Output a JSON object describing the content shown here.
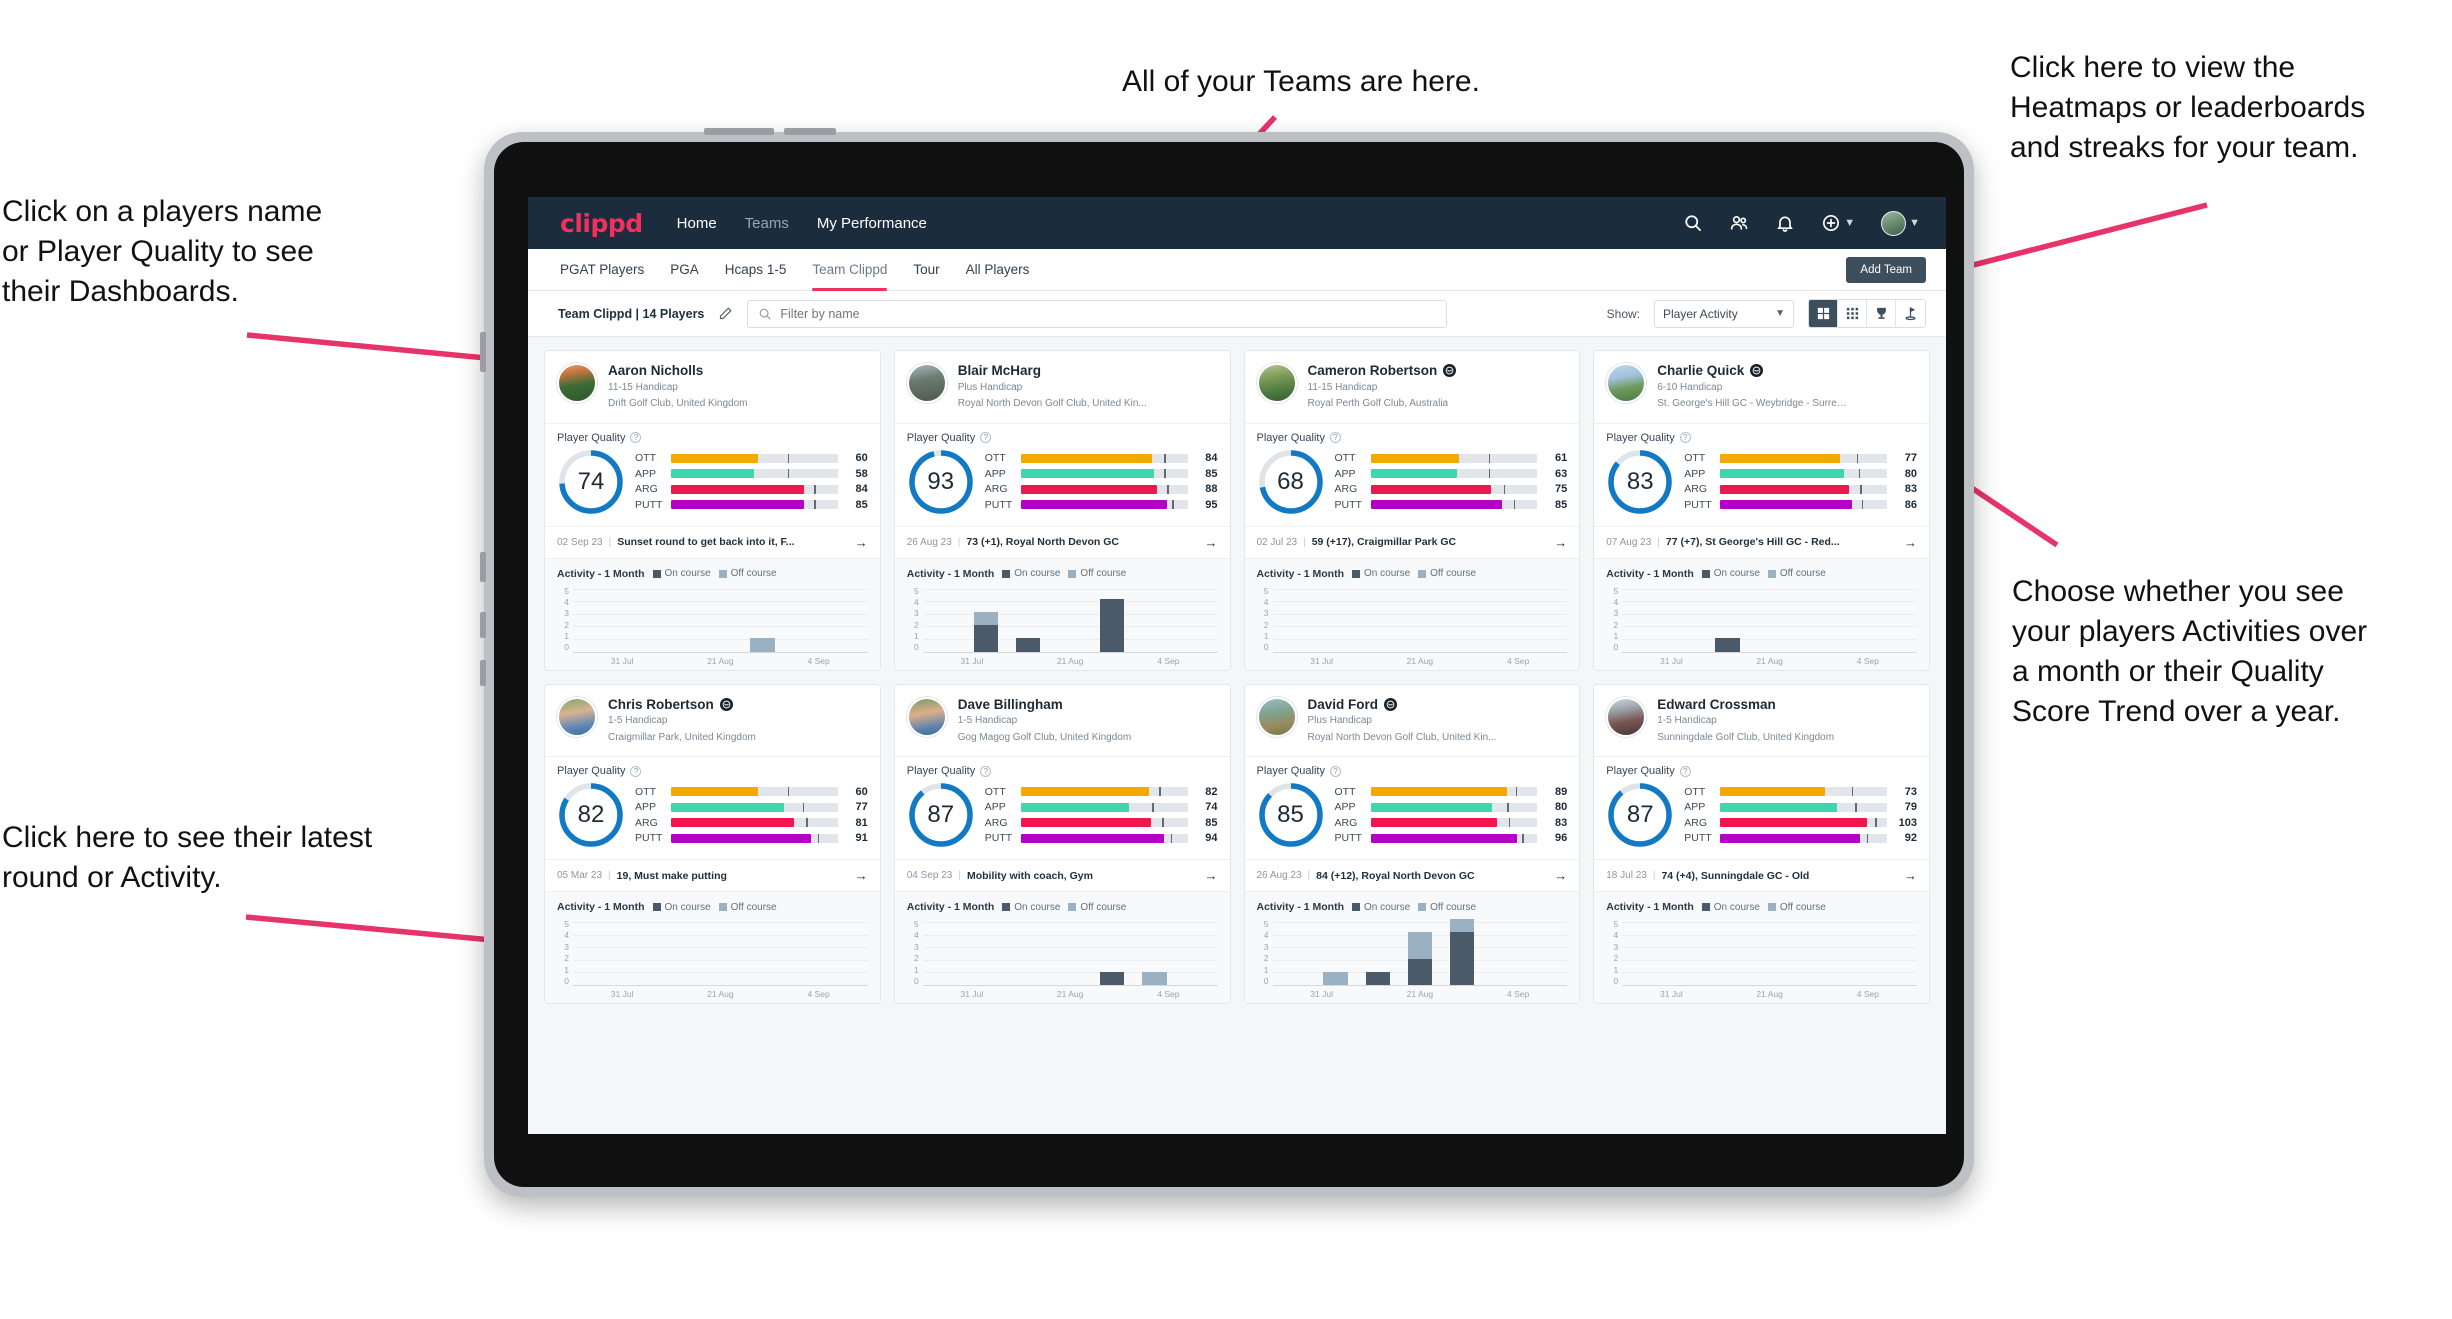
{
  "annotations": [
    {
      "id": "players-name",
      "text": "Click on a players name\nor Player Quality to see\ntheir Dashboards."
    },
    {
      "id": "teams-here",
      "text": "All of your Teams are here."
    },
    {
      "id": "heatmaps",
      "text": "Click here to view the\nHeatmaps or leaderboards\nand streaks for your team."
    },
    {
      "id": "activities-quality",
      "text": "Choose whether you see\nyour players Activities over\na month or their Quality\nScore Trend over a year."
    },
    {
      "id": "latest-round",
      "text": "Click here to see their latest\nround or Activity."
    }
  ],
  "app": {
    "logo": "clippd",
    "nav": [
      {
        "label": "Home",
        "active": true
      },
      {
        "label": "Teams",
        "active": false
      },
      {
        "label": "My Performance",
        "active": true
      }
    ],
    "header_icons": [
      "search-icon",
      "people-icon",
      "bell-icon",
      "plus-circle-icon",
      "avatar"
    ],
    "tabs": [
      {
        "label": "PGAT Players",
        "active": false
      },
      {
        "label": "PGA",
        "active": false
      },
      {
        "label": "Hcaps 1-5",
        "active": false
      },
      {
        "label": "Team Clippd",
        "active": true
      },
      {
        "label": "Tour",
        "active": false
      },
      {
        "label": "All Players",
        "active": false
      }
    ],
    "add_team_label": "Add Team",
    "toolbar": {
      "team_label": "Team Clippd | 14 Players",
      "edit_icon": "pencil-icon",
      "search_placeholder": "Filter by name",
      "search_value": "",
      "show_label": "Show:",
      "show_selected": "Player Activity",
      "show_options": [
        "Player Activity",
        "Quality Score Trend"
      ],
      "view_toggles": [
        {
          "name": "grid-large-view",
          "active": true
        },
        {
          "name": "grid-small-view",
          "active": false
        },
        {
          "name": "leaderboard-trophy-view",
          "active": false
        },
        {
          "name": "heatmap-flag-view",
          "active": false
        }
      ]
    },
    "card_labels": {
      "player_quality": "Player Quality",
      "activity": "Activity - 1 Month",
      "legend_on": "On course",
      "legend_off": "Off course"
    },
    "colors": {
      "brand_pink": "#f0305e",
      "header_navy": "#1b2c3c",
      "ring_blue": "#1279c4",
      "ott": "#f5a800",
      "app": "#3fd6ae",
      "arg": "#f0174f",
      "putt": "#b500c8",
      "on_course": "#4a5a68",
      "off_course": "#9ab0c3"
    }
  },
  "chart_data": {
    "type": "bar",
    "title": "Activity - 1 Month",
    "ylabel": "",
    "xlabel": "",
    "ylim": [
      0,
      5
    ],
    "yticks": [
      0,
      1,
      2,
      3,
      4,
      5
    ],
    "xticks": [
      "31 Jul",
      "21 Aug",
      "4 Sep"
    ],
    "legend": [
      "On course",
      "Off course"
    ],
    "legend_position": "top",
    "grid": true,
    "charts": [
      {
        "player": "Aaron Nicholls",
        "on_course": [
          0,
          0,
          0,
          0,
          0,
          0,
          0
        ],
        "off_course": [
          0,
          0,
          0,
          0,
          1,
          0,
          0
        ]
      },
      {
        "player": "Blair McHarg",
        "on_course": [
          0,
          2,
          1,
          0,
          4,
          0,
          0
        ],
        "off_course": [
          0,
          1,
          0,
          0,
          0,
          0,
          0
        ]
      },
      {
        "player": "Cameron Robertson",
        "on_course": [
          0,
          0,
          0,
          0,
          0,
          0,
          0
        ],
        "off_course": [
          0,
          0,
          0,
          0,
          0,
          0,
          0
        ]
      },
      {
        "player": "Charlie Quick",
        "on_course": [
          0,
          0,
          1,
          0,
          0,
          0,
          0
        ],
        "off_course": [
          0,
          0,
          0,
          0,
          0,
          0,
          0
        ]
      },
      {
        "player": "Chris Robertson",
        "on_course": [
          0,
          0,
          0,
          0,
          0,
          0,
          0
        ],
        "off_course": [
          0,
          0,
          0,
          0,
          0,
          0,
          0
        ]
      },
      {
        "player": "Dave Billingham",
        "on_course": [
          0,
          0,
          0,
          0,
          1,
          0,
          0
        ],
        "off_course": [
          0,
          0,
          0,
          0,
          0,
          1,
          0
        ]
      },
      {
        "player": "David Ford",
        "on_course": [
          0,
          0,
          1,
          2,
          4,
          0,
          0
        ],
        "off_course": [
          0,
          1,
          0,
          2,
          1,
          0,
          0
        ]
      },
      {
        "player": "Edward Crossman",
        "on_course": [
          0,
          0,
          0,
          0,
          0,
          0,
          0
        ],
        "off_course": [
          0,
          0,
          0,
          0,
          0,
          0,
          0
        ]
      }
    ]
  },
  "players": [
    {
      "name": "Aaron Nicholls",
      "verified": false,
      "handicap": "11-15 Handicap",
      "club": "Drift Golf Club, United Kingdom",
      "quality": 74,
      "ring_pct": 74,
      "metrics": [
        {
          "label": "OTT",
          "value": 60,
          "fill": 52,
          "tick": 70
        },
        {
          "label": "APP",
          "value": 58,
          "fill": 50,
          "tick": 70
        },
        {
          "label": "ARG",
          "value": 84,
          "fill": 80,
          "tick": 86
        },
        {
          "label": "PUTT",
          "value": 85,
          "fill": 80,
          "tick": 86
        }
      ],
      "latest_date": "02 Sep 23",
      "latest_text": "Sunset round to get back into it, F...",
      "avatar_css": "linear-gradient(170deg,#e9a07a 0%,#c9763f 22%,#3c6b36 55%,#2c5a2c 100%)"
    },
    {
      "name": "Blair McHarg",
      "verified": false,
      "handicap": "Plus Handicap",
      "club": "Royal North Devon Golf Club, United Kin...",
      "quality": 93,
      "ring_pct": 96,
      "metrics": [
        {
          "label": "OTT",
          "value": 84,
          "fill": 79,
          "tick": 86
        },
        {
          "label": "APP",
          "value": 85,
          "fill": 80,
          "tick": 86
        },
        {
          "label": "ARG",
          "value": 88,
          "fill": 82,
          "tick": 88
        },
        {
          "label": "PUTT",
          "value": 95,
          "fill": 88,
          "tick": 91
        }
      ],
      "latest_date": "26 Aug 23",
      "latest_text": "73 (+1), Royal North Devon GC",
      "avatar_css": "linear-gradient(170deg,#a8b6bd 0%,#6b7b70 40%,#4c5a4a 100%)"
    },
    {
      "name": "Cameron Robertson",
      "verified": true,
      "handicap": "11-15 Handicap",
      "club": "Royal Perth Golf Club, Australia",
      "quality": 68,
      "ring_pct": 72,
      "metrics": [
        {
          "label": "OTT",
          "value": 61,
          "fill": 53,
          "tick": 71
        },
        {
          "label": "APP",
          "value": 63,
          "fill": 52,
          "tick": 71
        },
        {
          "label": "ARG",
          "value": 75,
          "fill": 72,
          "tick": 80
        },
        {
          "label": "PUTT",
          "value": 85,
          "fill": 79,
          "tick": 86
        }
      ],
      "latest_date": "02 Jul 23",
      "latest_text": "59 (+17), Craigmillar Park GC",
      "avatar_css": "linear-gradient(170deg,#b9c48f 0%,#7d9a5a 35%,#4d7a3e 70%,#3b5c2f 100%)"
    },
    {
      "name": "Charlie Quick",
      "verified": true,
      "handicap": "6-10 Handicap",
      "club": "St. George's Hill GC - Weybridge - Surrey, ...",
      "quality": 83,
      "ring_pct": 86,
      "metrics": [
        {
          "label": "OTT",
          "value": 77,
          "fill": 72,
          "tick": 82
        },
        {
          "label": "APP",
          "value": 80,
          "fill": 74,
          "tick": 83
        },
        {
          "label": "ARG",
          "value": 83,
          "fill": 77,
          "tick": 84
        },
        {
          "label": "PUTT",
          "value": 86,
          "fill": 79,
          "tick": 85
        }
      ],
      "latest_date": "07 Aug 23",
      "latest_text": "77 (+7), St George's Hill GC - Red...",
      "avatar_css": "linear-gradient(170deg,#bcd6ea 0%,#9fc2db 35%,#6f9a5d 62%,#4e7a42 100%)"
    },
    {
      "name": "Chris Robertson",
      "verified": true,
      "handicap": "1-5 Handicap",
      "club": "Craigmillar Park, United Kingdom",
      "quality": 82,
      "ring_pct": 84,
      "metrics": [
        {
          "label": "OTT",
          "value": 60,
          "fill": 52,
          "tick": 70
        },
        {
          "label": "APP",
          "value": 77,
          "fill": 68,
          "tick": 79
        },
        {
          "label": "ARG",
          "value": 81,
          "fill": 74,
          "tick": 81
        },
        {
          "label": "PUTT",
          "value": 91,
          "fill": 84,
          "tick": 88
        }
      ],
      "latest_date": "05 Mar 23",
      "latest_text": "19, Must make putting",
      "avatar_css": "linear-gradient(170deg,#7fa86a 0%,#d8b292 38%,#5d86b6 74%,#3f6f96 100%)"
    },
    {
      "name": "Dave Billingham",
      "verified": false,
      "handicap": "1-5 Handicap",
      "club": "Gog Magog Golf Club, United Kingdom",
      "quality": 87,
      "ring_pct": 89,
      "metrics": [
        {
          "label": "OTT",
          "value": 82,
          "fill": 77,
          "tick": 83
        },
        {
          "label": "APP",
          "value": 74,
          "fill": 65,
          "tick": 79
        },
        {
          "label": "ARG",
          "value": 85,
          "fill": 78,
          "tick": 85
        },
        {
          "label": "PUTT",
          "value": 94,
          "fill": 86,
          "tick": 90
        }
      ],
      "latest_date": "04 Sep 23",
      "latest_text": "Mobility with coach, Gym",
      "avatar_css": "linear-gradient(170deg,#7c9b64 0%,#dcae8c 40%,#5a7fae 78%,#3c6a92 100%)"
    },
    {
      "name": "David Ford",
      "verified": true,
      "handicap": "Plus Handicap",
      "club": "Royal North Devon Golf Club, United Kin...",
      "quality": 85,
      "ring_pct": 87,
      "metrics": [
        {
          "label": "OTT",
          "value": 89,
          "fill": 82,
          "tick": 87
        },
        {
          "label": "APP",
          "value": 80,
          "fill": 73,
          "tick": 82
        },
        {
          "label": "ARG",
          "value": 83,
          "fill": 76,
          "tick": 83
        },
        {
          "label": "PUTT",
          "value": 96,
          "fill": 88,
          "tick": 91
        }
      ],
      "latest_date": "26 Aug 23",
      "latest_text": "84 (+12), Royal North Devon GC",
      "avatar_css": "linear-gradient(170deg,#9fb9cc 0%,#7fa38d 38%,#9a8a5e 70%,#6c7a4e 100%)"
    },
    {
      "name": "Edward Crossman",
      "verified": false,
      "handicap": "1-5 Handicap",
      "club": "Sunningdale Golf Club, United Kingdom",
      "quality": 87,
      "ring_pct": 89,
      "metrics": [
        {
          "label": "OTT",
          "value": 73,
          "fill": 63,
          "tick": 79
        },
        {
          "label": "APP",
          "value": 79,
          "fill": 70,
          "tick": 81
        },
        {
          "label": "ARG",
          "value": 103,
          "fill": 88,
          "tick": 93
        },
        {
          "label": "PUTT",
          "value": 92,
          "fill": 84,
          "tick": 88
        }
      ],
      "latest_date": "18 Jul 23",
      "latest_text": "74 (+4), Sunningdale GC - Old",
      "avatar_css": "linear-gradient(170deg,#cfd6dc 0%,#9ba4ab 30%,#7a5350 62%,#3f3b3a 100%)"
    }
  ]
}
